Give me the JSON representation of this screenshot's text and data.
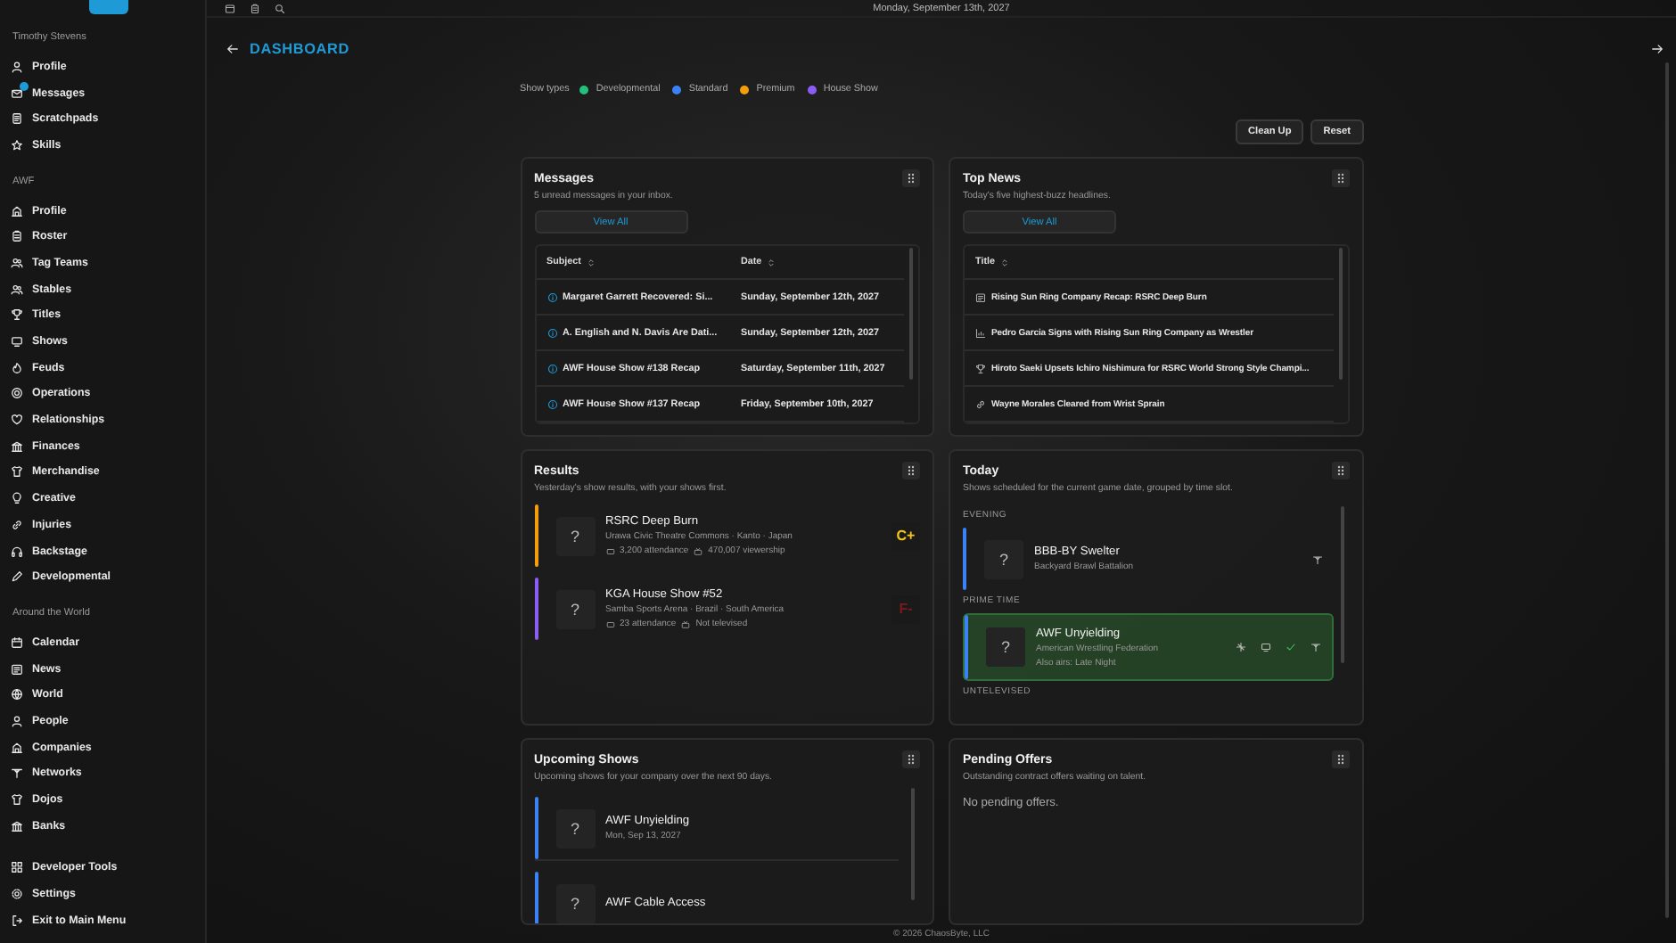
{
  "top_bar": {
    "date": "Monday, September 13th, 2027"
  },
  "sidebar": {
    "sections": [
      {
        "label": "Timothy Stevens",
        "items": [
          {
            "label": "Profile",
            "badge": false
          },
          {
            "label": "Messages",
            "badge": true
          },
          {
            "label": "Scratchpads",
            "badge": false
          },
          {
            "label": "Skills",
            "badge": false
          }
        ]
      },
      {
        "label": "AWF",
        "items": [
          {
            "label": "Profile",
            "badge": false
          },
          {
            "label": "Roster",
            "badge": false
          },
          {
            "label": "Tag Teams",
            "badge": false
          },
          {
            "label": "Stables",
            "badge": false
          },
          {
            "label": "Titles",
            "badge": false
          },
          {
            "label": "Shows",
            "badge": false
          },
          {
            "label": "Feuds",
            "badge": false
          },
          {
            "label": "Operations",
            "badge": false
          },
          {
            "label": "Relationships",
            "badge": false
          },
          {
            "label": "Finances",
            "badge": false
          },
          {
            "label": "Merchandise",
            "badge": false
          },
          {
            "label": "Creative",
            "badge": false
          },
          {
            "label": "Injuries",
            "badge": false
          },
          {
            "label": "Backstage",
            "badge": false
          },
          {
            "label": "Developmental",
            "badge": false
          }
        ]
      },
      {
        "label": "Around the World",
        "items": [
          {
            "label": "Calendar",
            "badge": false
          },
          {
            "label": "News",
            "badge": false
          },
          {
            "label": "World",
            "badge": false
          },
          {
            "label": "People",
            "badge": false
          },
          {
            "label": "Companies",
            "badge": false
          },
          {
            "label": "Networks",
            "badge": false
          },
          {
            "label": "Dojos",
            "badge": false
          },
          {
            "label": "Banks",
            "badge": false
          }
        ]
      },
      {
        "items": [
          {
            "label": "Developer Tools",
            "badge": false
          },
          {
            "label": "Settings",
            "badge": false
          },
          {
            "label": "Exit to Main Menu",
            "badge": false
          }
        ]
      }
    ]
  },
  "header": {
    "title": "DASHBOARD"
  },
  "legend": {
    "label": "Show types",
    "items": [
      {
        "label": "Developmental",
        "color": "#22c07a"
      },
      {
        "label": "Standard",
        "color": "#3b82f6"
      },
      {
        "label": "Premium",
        "color": "#f59e0b"
      },
      {
        "label": "House Show",
        "color": "#8b5cf6"
      }
    ]
  },
  "actions": [
    "Clean Up",
    "Reset"
  ],
  "messages": {
    "title": "Messages",
    "subtitle": "5 unread messages in your inbox.",
    "button": "View All",
    "columns": [
      "Subject",
      "Date"
    ],
    "rows": [
      {
        "subject": "Margaret Garrett Recovered: Si...",
        "date": "Sunday, September 12th, 2027"
      },
      {
        "subject": "A. English and N. Davis Are Dati...",
        "date": "Sunday, September 12th, 2027"
      },
      {
        "subject": "AWF House Show #138 Recap",
        "date": "Saturday, September 11th, 2027"
      },
      {
        "subject": "AWF House Show #137 Recap",
        "date": "Friday, September 10th, 2027"
      }
    ]
  },
  "top_news": {
    "title": "Top News",
    "subtitle": "Today's five highest-buzz headlines.",
    "button": "View All",
    "columns": [
      "Title"
    ],
    "rows": [
      {
        "title": "Rising Sun Ring Company Recap: RSRC Deep Burn"
      },
      {
        "title": "Pedro Garcia Signs with Rising Sun Ring Company as Wrestler"
      },
      {
        "title": "Hiroto Saeki Upsets Ichiro Nishimura for RSRC World Strong Style Champi..."
      },
      {
        "title": "Wayne Morales Cleared from Wrist Sprain"
      }
    ]
  },
  "results": {
    "title": "Results",
    "subtitle": "Yesterday's show results, with your shows first.",
    "items": [
      {
        "thumb": "?",
        "title": "RSRC Deep Burn",
        "location": "Urawa Civic Theatre Commons · Kanto · Japan",
        "attendance": "3,200 attendance",
        "viewership": "470,007 viewership",
        "grade": {
          "text": "C+",
          "color": "#f5c518"
        },
        "color": "#f59e0b"
      },
      {
        "thumb": "?",
        "title": "KGA House Show #52",
        "location": "Samba Sports Arena · Brazil · South America",
        "attendance": "23 attendance",
        "viewership": "Not televised",
        "grade": {
          "text": "F-",
          "color": "#7a1c1c"
        },
        "color": "#8b5cf6"
      }
    ]
  },
  "today": {
    "title": "Today",
    "subtitle": "Shows scheduled for the current game date, grouped by time slot.",
    "groups": [
      {
        "label": "EVENING",
        "items": [
          {
            "thumb": "?",
            "title": "BBB-BY Swelter",
            "lines": [
              "Backyard Brawl Battalion"
            ],
            "selected": false,
            "color": "#3b82f6"
          }
        ]
      },
      {
        "label": "PRIME TIME",
        "items": [
          {
            "thumb": "?",
            "title": "AWF Unyielding",
            "lines": [
              "American Wrestling Federation",
              "Also airs: Late Night"
            ],
            "selected": true,
            "color": "#3b82f6"
          }
        ]
      },
      {
        "label": "UNTELEVISED"
      }
    ]
  },
  "upcoming": {
    "title": "Upcoming Shows",
    "subtitle": "Upcoming shows for your company over the next 90 days.",
    "items": [
      {
        "thumb": "?",
        "title": "AWF Unyielding",
        "date": "Mon, Sep 13, 2027",
        "color": "#3b82f6"
      },
      {
        "thumb": "?",
        "title": "AWF Cable Access",
        "color": "#3b82f6"
      }
    ]
  },
  "pending": {
    "title": "Pending Offers",
    "subtitle": "Outstanding contract offers waiting on talent.",
    "empty": "No pending offers."
  },
  "footer": "© 2026 ChaosByte, LLC"
}
